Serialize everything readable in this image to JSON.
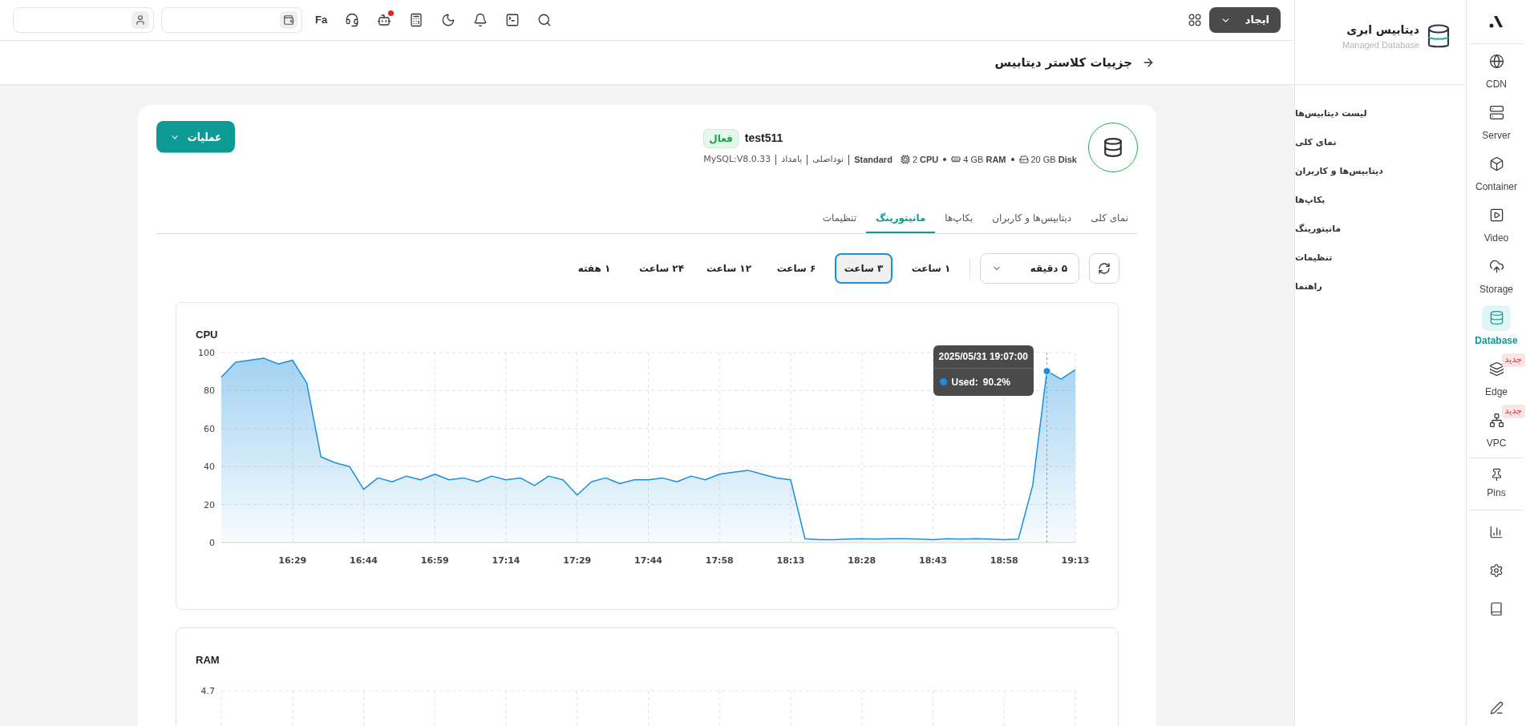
{
  "topbar": {
    "language": "Fa",
    "notification_dot": true,
    "create_button": "ایجاد"
  },
  "page_title": "جزییات کلاستر دیتابیس",
  "product": {
    "title": "دیتابیس ابری",
    "subtitle": "Managed Database"
  },
  "menu": [
    {
      "label": "لیست دیتابیس‌ها"
    },
    {
      "label": "نمای کلی"
    },
    {
      "label": "دیتابیس‌ها و کاربران"
    },
    {
      "label": "بکاپ‌ها"
    },
    {
      "label": "مانیتورینگ"
    },
    {
      "label": "تنظیمات"
    },
    {
      "label": "راهنما"
    }
  ],
  "rail": {
    "services": [
      {
        "label": "CDN",
        "selected": false
      },
      {
        "label": "Server",
        "selected": false
      },
      {
        "label": "Container",
        "selected": false
      },
      {
        "label": "Video",
        "selected": false
      },
      {
        "label": "Storage",
        "selected": false
      },
      {
        "label": "Database",
        "selected": true
      },
      {
        "label": "Edge",
        "selected": false,
        "badge": "جدید"
      },
      {
        "label": "VPC",
        "selected": false,
        "badge": "جدید"
      }
    ],
    "pins": {
      "label": "Pins"
    }
  },
  "cluster": {
    "name": "test511",
    "status": "فعال",
    "specs": [
      {
        "kind": "disk",
        "amount": "20 GB",
        "unit": "Disk"
      },
      {
        "kind": "ram",
        "amount": "4 GB",
        "unit": "RAM"
      },
      {
        "kind": "cpu",
        "amount": "2",
        "unit": "CPU"
      }
    ],
    "plan": "Standard",
    "details": [
      "نوداصلی",
      "بامداد",
      "MySQL:V8.0.33"
    ],
    "actions_button": "عملیات"
  },
  "tabs": [
    {
      "label": "نمای کلی",
      "selected": false
    },
    {
      "label": "دیتابیس‌ها و کاربران",
      "selected": false
    },
    {
      "label": "بکاپ‌ها",
      "selected": false
    },
    {
      "label": "مانیتورینگ",
      "selected": true
    },
    {
      "label": "تنظیمات",
      "selected": false
    }
  ],
  "interval": {
    "value": "۵ دقیقه"
  },
  "ranges": [
    {
      "label": "۱ ساعت",
      "selected": false
    },
    {
      "label": "۳ ساعت",
      "selected": true
    },
    {
      "label": "۶ ساعت",
      "selected": false
    },
    {
      "label": "۱۲ ساعت",
      "selected": false
    },
    {
      "label": "۲۴ ساعت",
      "selected": false
    },
    {
      "label": "۱ هفته",
      "selected": false
    }
  ],
  "cpu": {
    "title": "CPU",
    "chart_data": {
      "type": "area",
      "ylim": [
        0,
        100
      ],
      "categories": [
        null,
        null,
        null,
        null,
        null,
        "16:29",
        null,
        null,
        null,
        null,
        "16:44",
        null,
        null,
        null,
        null,
        "16:59",
        null,
        null,
        null,
        null,
        "17:14",
        null,
        null,
        null,
        null,
        "17:29",
        null,
        null,
        null,
        null,
        "17:44",
        null,
        null,
        null,
        null,
        "17:58",
        null,
        null,
        null,
        null,
        "18:13",
        null,
        null,
        null,
        null,
        "18:28",
        null,
        null,
        null,
        null,
        "18:43",
        null,
        null,
        null,
        null,
        "18:58",
        null,
        null,
        null,
        null,
        "19:13"
      ],
      "series": [
        {
          "color": "#1a8fdf",
          "values": [
            87,
            95,
            96,
            97,
            94,
            96,
            84,
            45,
            42,
            40,
            28,
            34,
            32,
            35,
            33,
            36,
            33,
            34,
            32,
            35,
            33,
            34,
            30,
            35,
            33,
            25,
            32,
            34,
            31,
            33,
            33,
            34,
            32,
            35,
            33,
            36,
            37,
            38,
            36,
            34,
            33,
            2,
            1.5,
            1.5,
            1.8,
            2,
            1.8,
            2,
            2,
            1.8,
            1.5,
            2,
            1.8,
            2,
            1.8,
            1.5,
            1.8,
            30,
            90.2,
            86,
            91
          ]
        }
      ],
      "yticks": [
        0,
        20,
        40,
        60,
        80,
        100
      ],
      "grid": true
    },
    "tooltip": {
      "time": "2025/05/31 19:07:00",
      "label": "Used:",
      "value": "90.2%"
    }
  },
  "ram": {
    "title": "RAM",
    "top_tick": "4.7"
  }
}
